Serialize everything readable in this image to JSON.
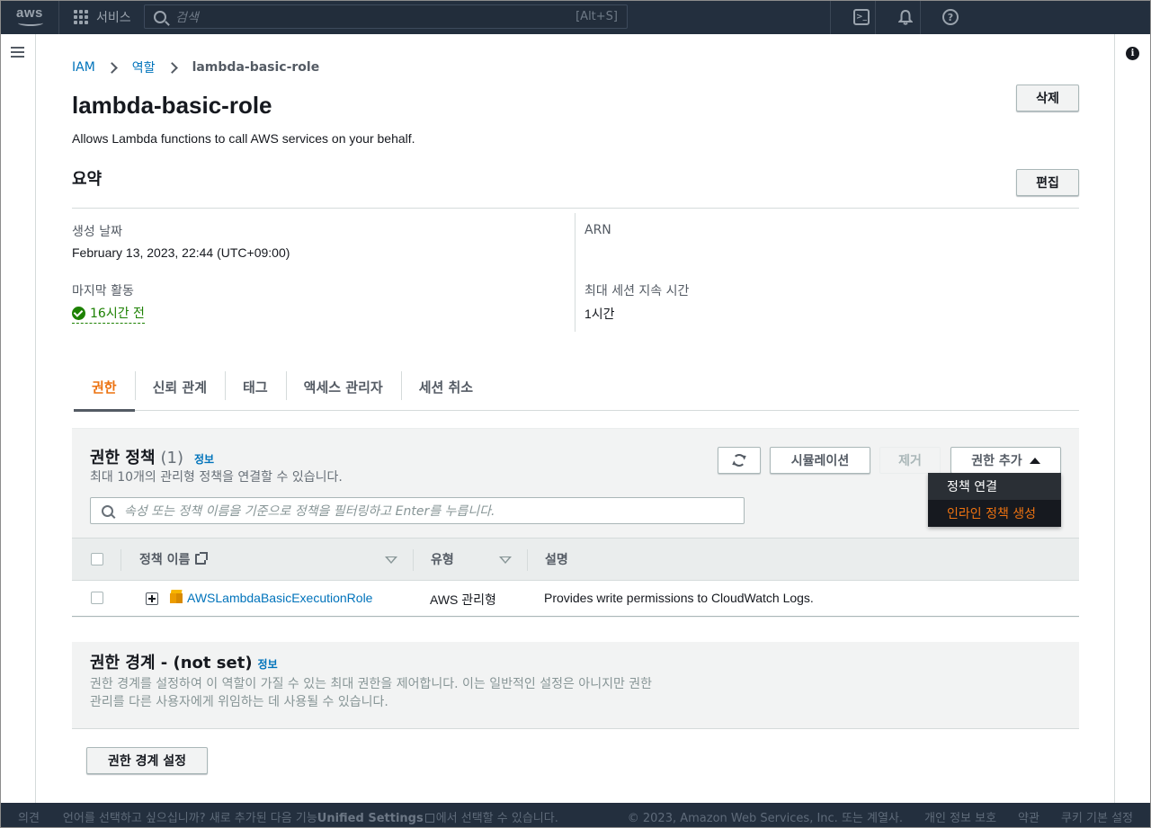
{
  "nav": {
    "logo_text": "aws",
    "services_label": "서비스",
    "search_placeholder": "검색",
    "search_shortcut": "[Alt+S]",
    "terminal_glyph": ">_",
    "bell_glyph": "🔔",
    "help_glyph": "?",
    "icons": [
      "cloudshell-icon",
      "bell-icon",
      "help-icon"
    ]
  },
  "breadcrumb": {
    "root": "IAM",
    "level2": "역할",
    "current": "lambda-basic-role"
  },
  "header": {
    "title": "lambda-basic-role",
    "description": "Allows Lambda functions to call AWS services on your behalf.",
    "delete_label": "삭제"
  },
  "summary": {
    "heading": "요약",
    "edit_label": "편집",
    "created_label": "생성 날짜",
    "created_value": "February 13, 2023, 22:44 (UTC+09:00)",
    "last_activity_label": "마지막 활동",
    "last_activity_value": "16시간 전",
    "arn_label": "ARN",
    "arn_value": "",
    "max_session_label": "최대 세션 지속 시간",
    "max_session_value": "1시간"
  },
  "tabs": [
    {
      "label": "권한",
      "active": true
    },
    {
      "label": "신뢰 관계",
      "active": false
    },
    {
      "label": "태그",
      "active": false
    },
    {
      "label": "액세스 관리자",
      "active": false
    },
    {
      "label": "세션 취소",
      "active": false
    }
  ],
  "policies": {
    "title": "권한 정책",
    "count": "(1)",
    "info_label": "정보",
    "subtitle": "최대 10개의 관리형 정책을 연결할 수 있습니다.",
    "simulation_label": "시뮬레이션",
    "remove_label": "제거",
    "add_label": "권한 추가",
    "filter_placeholder": "속성 또는 정책 이름을 기준으로 정책을 필터링하고 Enter를 누릅니다.",
    "columns": {
      "name": "정책 이름",
      "type": "유형",
      "description": "설명"
    },
    "rows": [
      {
        "name": "AWSLambdaBasicExecutionRole",
        "type": "AWS 관리형",
        "description": "Provides write permissions to CloudWatch Logs."
      }
    ],
    "menu": [
      {
        "label": "정책 연결",
        "highlighted": false
      },
      {
        "label": "인라인 정책 생성",
        "highlighted": true
      }
    ]
  },
  "boundary": {
    "title": "권한 경계 - (not set)",
    "info_label": "정보",
    "description": "권한 경계를 설정하여 이 역할이 가질 수 있는 최대 권한을 제어합니다. 이는 일반적인 설정은 아니지만 권한 관리를 다른 사용자에게 위임하는 데 사용될 수 있습니다.",
    "button_label": "권한 경계 설정"
  },
  "footer": {
    "feedback": "의견",
    "language_prompt_a": "언어를 선택하고 싶으십니까? 새로 추가된 다음 기능",
    "language_prompt_strong": "Unified Settings",
    "language_prompt_b": "에서 선택할 수 있습니다.",
    "copyright": "© 2023, Amazon Web Services, Inc. 또는 계열사.",
    "privacy": "개인 정보 보호",
    "terms": "약관",
    "cookies": "쿠키 기본 설정"
  },
  "colors": {
    "nav_bg": "#232f3e",
    "link": "#0073bb",
    "accent": "#ec7211",
    "success": "#1d8102"
  }
}
